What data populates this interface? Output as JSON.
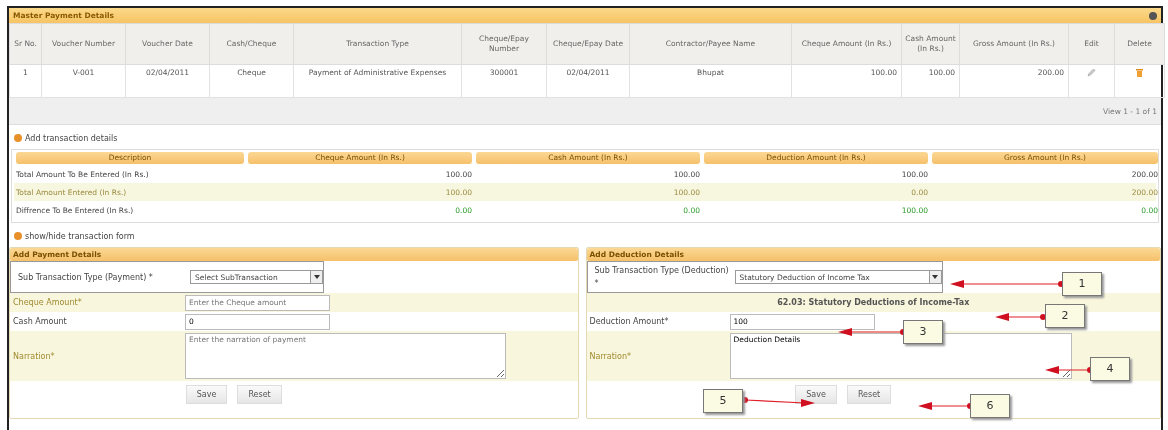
{
  "master": {
    "title": "Master Payment Details",
    "columns": [
      {
        "label": "Sr No.",
        "kind": "text"
      },
      {
        "label": "Voucher Number",
        "kind": "text"
      },
      {
        "label": "Voucher Date",
        "kind": "text"
      },
      {
        "label": "Cash/Cheque",
        "kind": "text"
      },
      {
        "label": "Transaction Type",
        "kind": "text"
      },
      {
        "label": "Cheque/Epay Number",
        "kind": "text"
      },
      {
        "label": "Cheque/Epay Date",
        "kind": "text"
      },
      {
        "label": "Contractor/Payee Name",
        "kind": "text"
      },
      {
        "label": "Cheque Amount (In Rs.)",
        "kind": "amount"
      },
      {
        "label": "Cash Amount (In Rs.)",
        "kind": "amount"
      },
      {
        "label": "Gross Amount (In Rs.)",
        "kind": "amount"
      },
      {
        "label": "Edit",
        "kind": "edit"
      },
      {
        "label": "Delete",
        "kind": "delete"
      }
    ],
    "rows": [
      {
        "cells": [
          "1",
          "V-001",
          "02/04/2011",
          "Cheque",
          "Payment of Administrative Expenses",
          "300001",
          "02/04/2011",
          "Bhupat",
          "100.00",
          "100.00",
          "200.00"
        ]
      }
    ],
    "pager": "View 1 - 1 of 1"
  },
  "add_transaction_link": "Add transaction details",
  "summary": {
    "columns": [
      "Description",
      "Cheque Amount (In Rs.)",
      "Cash Amount (In Rs.)",
      "Deduction Amount (In Rs.)",
      "Gross Amount (In Rs.)"
    ],
    "rows": [
      {
        "kind": "total",
        "description": "Total Amount To Be Entered (In Rs.)",
        "values": [
          "100.00",
          "100.00",
          "100.00",
          "200.00"
        ]
      },
      {
        "kind": "entered",
        "description": "Total Amount Entered (In Rs.)",
        "values": [
          "100.00",
          "100.00",
          "0.00",
          "200.00"
        ]
      },
      {
        "kind": "difference",
        "description": "Diffrence To Be Entered (In Rs.)",
        "values": [
          "0.00",
          "0.00",
          "100.00",
          "0.00"
        ]
      }
    ]
  },
  "toggle_link": "show/hide transaction form",
  "payment_panel": {
    "title": "Add Payment Details",
    "fields": [
      {
        "kind": "select",
        "label": "Sub Transaction Type (Payment) *",
        "value": "Select SubTransaction"
      },
      {
        "kind": "input",
        "label": "Cheque Amount*",
        "placeholder": "Enter the Cheque amount"
      },
      {
        "kind": "input",
        "label": "Cash Amount",
        "value": "0"
      },
      {
        "kind": "textarea",
        "label": "Narration*",
        "placeholder": "Enter the narration of payment"
      }
    ],
    "buttons": [
      "Save",
      "Reset"
    ]
  },
  "deduction_panel": {
    "title": "Add Deduction Details",
    "fields": [
      {
        "kind": "select",
        "label": "Sub Transaction Type (Deduction) *",
        "value": "Statutory Deduction of Income Tax"
      },
      {
        "kind": "note",
        "label": "62.03: Statutory Deductions of Income-Tax"
      },
      {
        "kind": "input",
        "label": "Deduction Amount*",
        "value": "100"
      },
      {
        "kind": "textarea",
        "label": "Narration*",
        "value": "Deduction Details"
      }
    ],
    "buttons": [
      "Save",
      "Reset"
    ]
  },
  "callouts": [
    "1",
    "2",
    "3",
    "4",
    "5",
    "6"
  ]
}
